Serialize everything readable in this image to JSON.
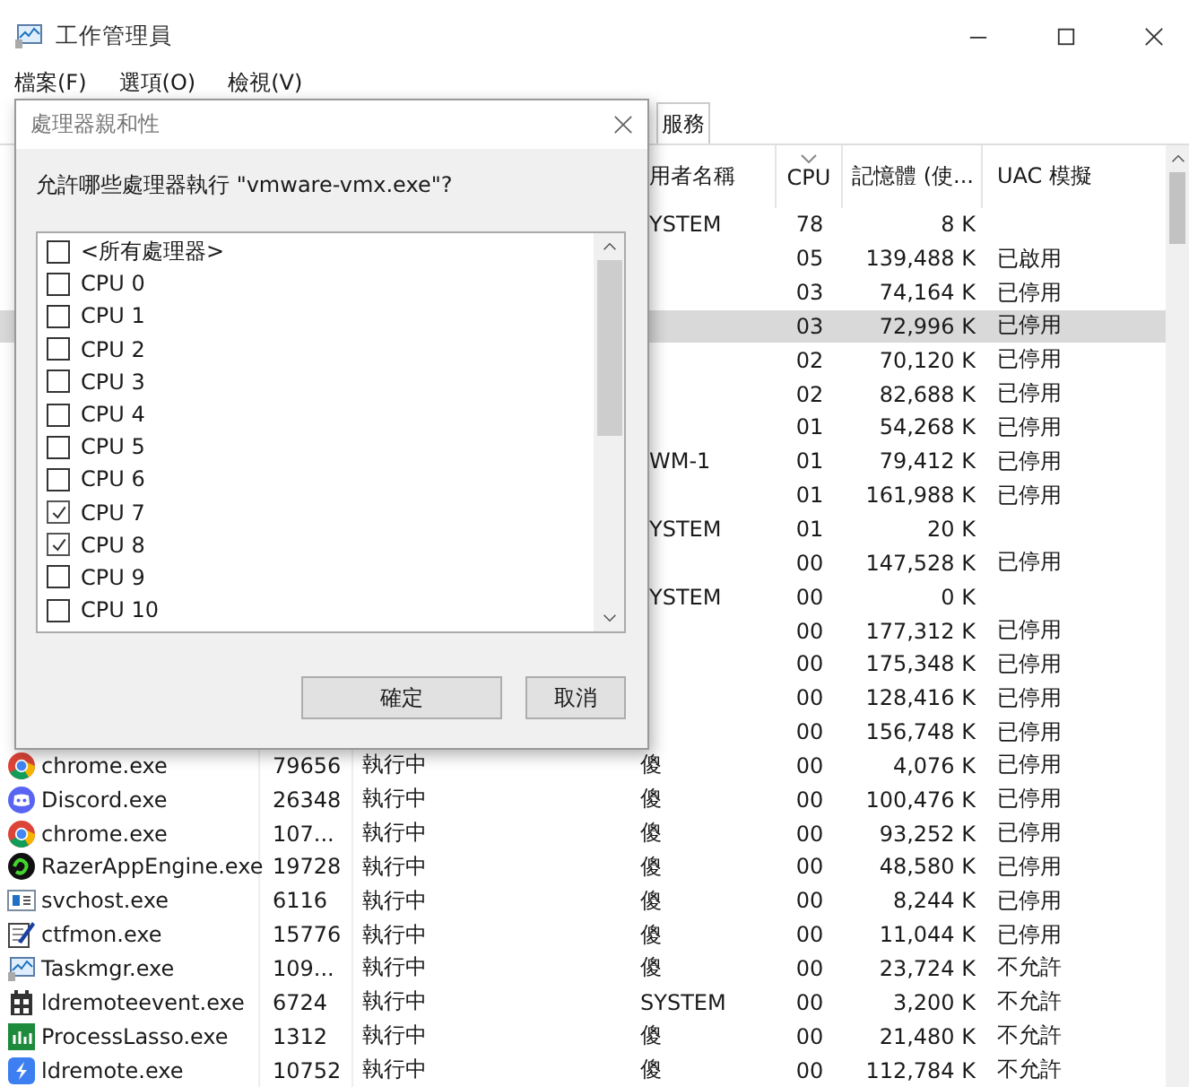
{
  "window": {
    "title": "工作管理員"
  },
  "menu": [
    "檔案(F)",
    "選項(O)",
    "檢視(V)"
  ],
  "tabs": [
    {
      "label": "服務",
      "selected": false
    }
  ],
  "table": {
    "columns": [
      {
        "label": "用者名稱",
        "sorted": false
      },
      {
        "label": "CPU",
        "sorted": true
      },
      {
        "label": "記憶體 (使...",
        "sorted": false
      },
      {
        "label": "UAC 模擬",
        "sorted": false
      }
    ],
    "rows": [
      {
        "user": "YSTEM",
        "cpu": "78",
        "memory": "8 K",
        "selected": false
      },
      {
        "cpu": "05",
        "memory": "139,488 K",
        "uac": "已啟用",
        "selected": false
      },
      {
        "cpu": "03",
        "memory": "74,164 K",
        "uac": "已停用",
        "selected": false
      },
      {
        "cpu": "03",
        "memory": "72,996 K",
        "uac": "已停用",
        "selected": true
      },
      {
        "cpu": "02",
        "memory": "70,120 K",
        "uac": "已停用",
        "selected": false
      },
      {
        "cpu": "02",
        "memory": "82,688 K",
        "uac": "已停用",
        "selected": false
      },
      {
        "cpu": "01",
        "memory": "54,268 K",
        "uac": "已停用",
        "selected": false
      },
      {
        "user": "WM-1",
        "cpu": "01",
        "memory": "79,412 K",
        "uac": "已停用",
        "selected": false
      },
      {
        "cpu": "01",
        "memory": "161,988 K",
        "uac": "已停用",
        "selected": false
      },
      {
        "user": "YSTEM",
        "cpu": "01",
        "memory": "20 K",
        "selected": false
      },
      {
        "cpu": "00",
        "memory": "147,528 K",
        "uac": "已停用",
        "selected": false
      },
      {
        "user": "YSTEM",
        "cpu": "00",
        "memory": "0 K",
        "selected": false
      },
      {
        "cpu": "00",
        "memory": "177,312 K",
        "uac": "已停用",
        "selected": false
      },
      {
        "cpu": "00",
        "memory": "175,348 K",
        "uac": "已停用",
        "selected": false
      },
      {
        "cpu": "00",
        "memory": "128,416 K",
        "uac": "已停用",
        "selected": false
      },
      {
        "cpu": "00",
        "memory": "156,748 K",
        "uac": "已停用",
        "selected": false
      },
      {
        "kind": "chrome",
        "name": "chrome.exe",
        "pid": "79656",
        "status": "執行中",
        "user": "傻",
        "cpu": "00",
        "memory": "4,076 K",
        "uac": "已停用",
        "selected": false
      },
      {
        "kind": "discord",
        "name": "Discord.exe",
        "pid": "26348",
        "status": "執行中",
        "user": "傻",
        "cpu": "00",
        "memory": "100,476 K",
        "uac": "已停用",
        "selected": false
      },
      {
        "kind": "chrome",
        "name": "chrome.exe",
        "pid": "107...",
        "status": "執行中",
        "user": "傻",
        "cpu": "00",
        "memory": "93,252 K",
        "uac": "已停用",
        "selected": false
      },
      {
        "kind": "razer",
        "name": "RazerAppEngine.exe",
        "pid": "19728",
        "status": "執行中",
        "user": "傻",
        "cpu": "00",
        "memory": "48,580 K",
        "uac": "已停用",
        "selected": false
      },
      {
        "kind": "service",
        "name": "svchost.exe",
        "pid": "6116",
        "status": "執行中",
        "user": "傻",
        "cpu": "00",
        "memory": "8,244 K",
        "uac": "已停用",
        "selected": false
      },
      {
        "kind": "notepad",
        "name": "ctfmon.exe",
        "pid": "15776",
        "status": "執行中",
        "user": "傻",
        "cpu": "00",
        "memory": "11,044 K",
        "uac": "已停用",
        "selected": false
      },
      {
        "kind": "monitor",
        "name": "Taskmgr.exe",
        "pid": "109...",
        "status": "執行中",
        "user": "傻",
        "cpu": "00",
        "memory": "23,724 K",
        "uac": "不允許",
        "selected": false
      },
      {
        "kind": "building",
        "name": "ldremoteevent.exe",
        "pid": "6724",
        "status": "執行中",
        "user": "SYSTEM",
        "cpu": "00",
        "memory": "3,200 K",
        "uac": "不允許",
        "selected": false
      },
      {
        "kind": "bars",
        "name": "ProcessLasso.exe",
        "pid": "1312",
        "status": "執行中",
        "user": "傻",
        "cpu": "00",
        "memory": "21,480 K",
        "uac": "不允許",
        "selected": false
      },
      {
        "kind": "bolt",
        "name": "ldremote.exe",
        "pid": "10752",
        "status": "執行中",
        "user": "傻",
        "cpu": "00",
        "memory": "112,784 K",
        "uac": "不允許",
        "selected": false
      }
    ]
  },
  "dialog": {
    "title": "處理器親和性",
    "prompt": "允許哪些處理器執行 \"vmware-vmx.exe\"?",
    "items": [
      {
        "label": "<所有處理器>",
        "checked": false
      },
      {
        "label": "CPU 0",
        "checked": false
      },
      {
        "label": "CPU 1",
        "checked": false
      },
      {
        "label": "CPU 2",
        "checked": false
      },
      {
        "label": "CPU 3",
        "checked": false
      },
      {
        "label": "CPU 4",
        "checked": false
      },
      {
        "label": "CPU 5",
        "checked": false
      },
      {
        "label": "CPU 6",
        "checked": false
      },
      {
        "label": "CPU 7",
        "checked": true
      },
      {
        "label": "CPU 8",
        "checked": true
      },
      {
        "label": "CPU 9",
        "checked": false
      },
      {
        "label": "CPU 10",
        "checked": false
      }
    ],
    "buttons": [
      "確定",
      "取消"
    ]
  }
}
